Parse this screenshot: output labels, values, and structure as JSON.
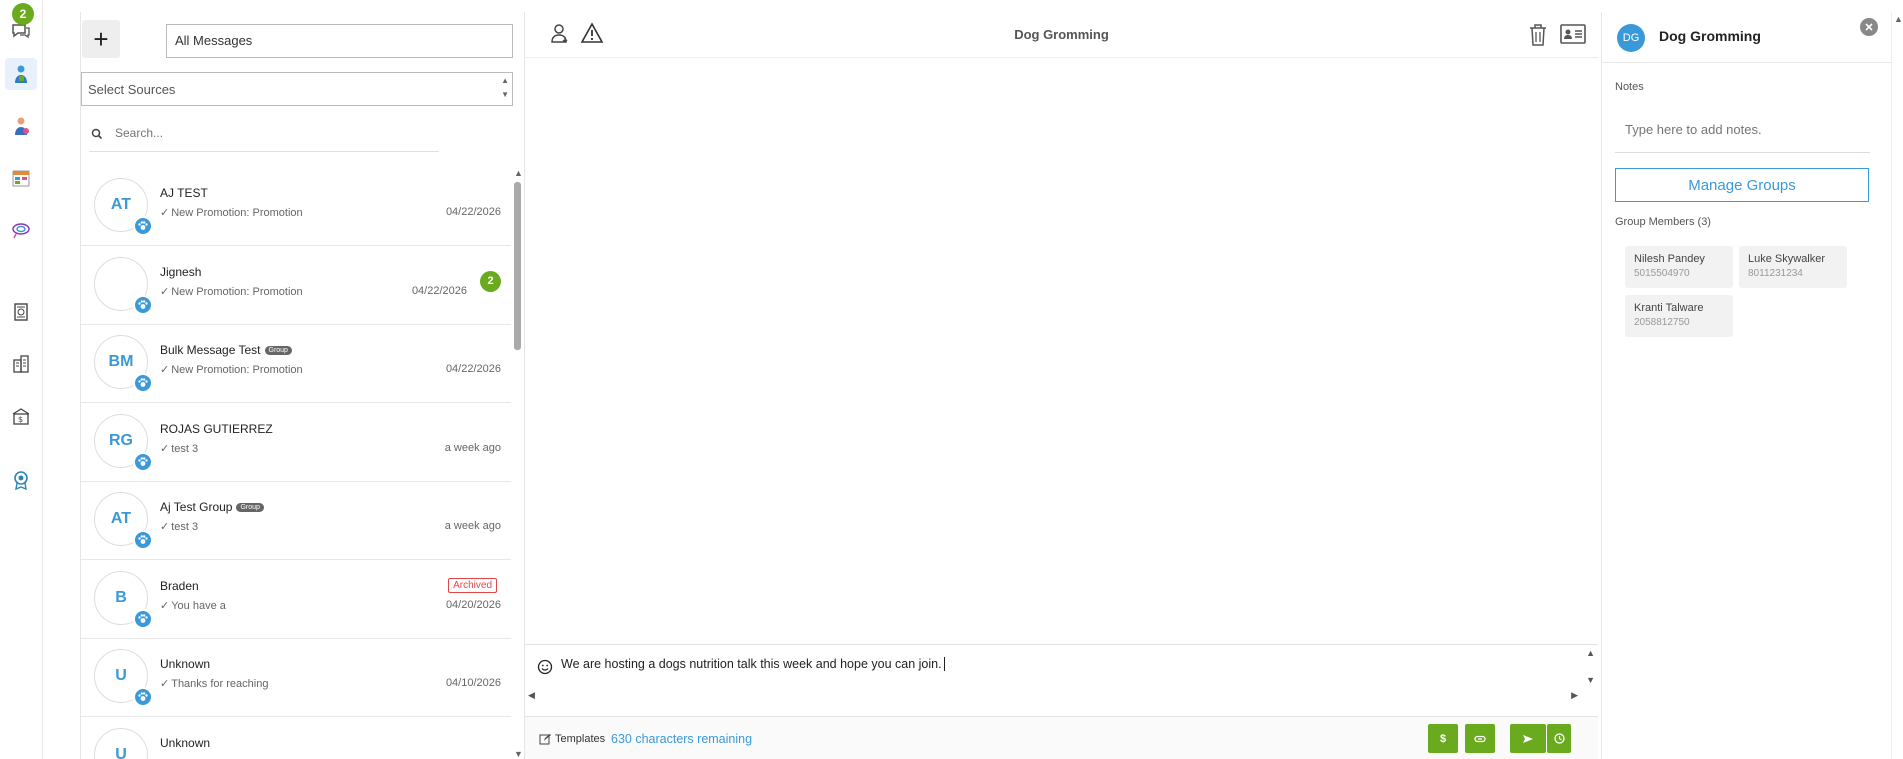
{
  "rail": {
    "badge": "2",
    "icons": [
      "chat-icon",
      "agent-icon",
      "profile-icon",
      "calendar-icon",
      "campaign-icon",
      "billing-icon",
      "building-icon",
      "building-dollar-icon",
      "award-icon"
    ]
  },
  "list": {
    "add_label": "+",
    "filter_value": "All Messages",
    "sources_placeholder": "Select Sources",
    "search_placeholder": "Search...",
    "conversations": [
      {
        "initials": "AT",
        "name": "AJ TEST",
        "message": "New Promotion: Promotion",
        "date": "04/22/2026"
      },
      {
        "initials": "",
        "name": "Jignesh",
        "message": "New Promotion: Promotion",
        "date": "04/22/2026",
        "unread": "2"
      },
      {
        "initials": "BM",
        "name": "Bulk Message Test",
        "group": "Group",
        "message": "New Promotion: Promotion",
        "date": "04/22/2026"
      },
      {
        "initials": "RG",
        "name": "ROJAS GUTIERREZ",
        "message": "test 3",
        "date": "a week ago"
      },
      {
        "initials": "AT",
        "name": "Aj Test Group",
        "group": "Group",
        "message": "test 3",
        "date": "a week ago"
      },
      {
        "initials": "B",
        "name": "Braden",
        "message": "You have a",
        "date": "04/20/2026",
        "status": "Archived"
      },
      {
        "initials": "U",
        "name": "Unknown",
        "message": "Thanks for reaching",
        "date": "04/10/2026"
      },
      {
        "initials": "U",
        "name": "Unknown",
        "message": "",
        "date": ""
      }
    ]
  },
  "chat": {
    "title": "Dog Gromming",
    "composer_text": "We are hosting a dogs nutrition talk this week and hope you can join.",
    "templates_label": "Templates",
    "chars_remaining": "630 characters remaining",
    "dollar_label": "$"
  },
  "details": {
    "initials": "DG",
    "name": "Dog Gromming",
    "notes_label": "Notes",
    "notes_placeholder": "Type here to add notes.",
    "manage_groups": "Manage Groups",
    "members_label": "Group Members (3)",
    "members": [
      {
        "name": "Nilesh Pandey",
        "phone": "5015504970"
      },
      {
        "name": "Luke Skywalker",
        "phone": "8011231234"
      },
      {
        "name": "Kranti Talware",
        "phone": "2058812750"
      }
    ]
  },
  "colors": {
    "accent": "#3a99d8",
    "green": "#6aaa1e",
    "archived": "#e04848"
  }
}
